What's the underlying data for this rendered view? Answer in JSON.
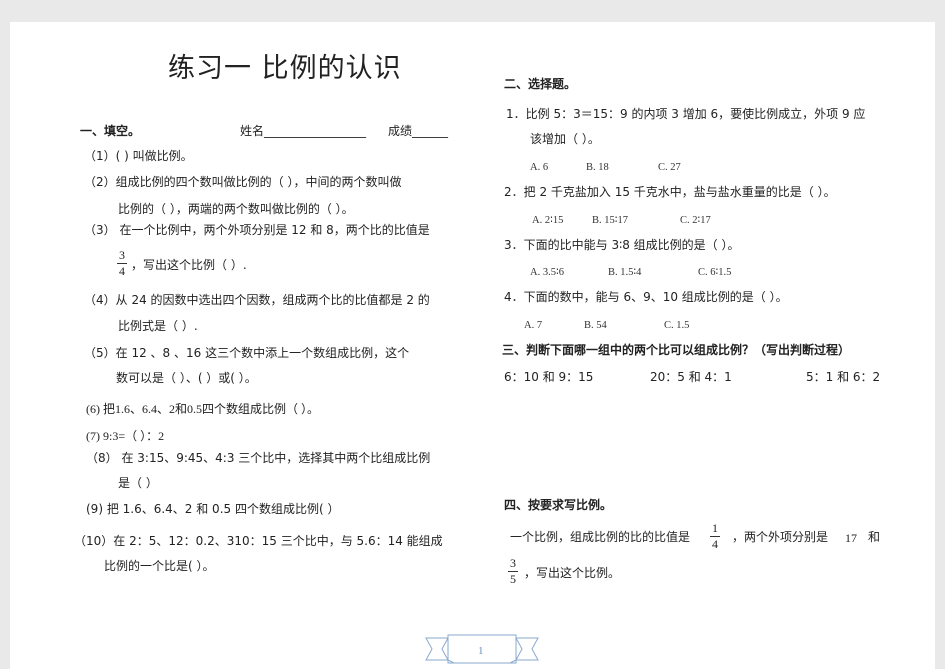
{
  "title": "练习一 比例的认识",
  "s1": {
    "heading": "一、填空。",
    "name_line": "姓名_________________",
    "score_line": "成绩______",
    "q1": "（1）(                                                      ) 叫做比例。",
    "q2a": "（2）组成比例的四个数叫做比例的（        ），中间的两个数叫做",
    "q2b": "比例的（            ），两端的两个数叫做比例的（            ）。",
    "q3a": "（3）  在一个比例中，两个外项分别是 12 和 8，两个比的比值是",
    "q3_num": "3",
    "q3_den": "4",
    "q3b": "，写出这个比例（                                          ）.",
    "q4a": "（4）从 24 的因数中选出四个因数，组成两个比的比值都是 2 的",
    "q4b": "比例式是（                                                    ）.",
    "q5a": "（5）在 12   、8   、16   这三个数中添上一个数组成比例，这个",
    "q5b": "数可以是（              ）、(              ）或(              ）。",
    "q6": "(6)  把1.6、6.4、2和0.5四个数组成比例（                                    ）。",
    "q7": "(7)   9:3=（      ）：2",
    "q8a": "（8）  在 3:15、9:45、4:3 三个比中，选择其中两个比组成比例",
    "q8b": "是（                          ）",
    "q9": "(9)  把 1.6、6.4、2 和 0.5 四个数组成比例(                                    ）",
    "q10a": "（10）在 2：5、12：0.2、310：15 三个比中，与 5.6：14 能组成",
    "q10b": "比例的一个比是(                   ）。"
  },
  "s2": {
    "heading": "二、选择题。",
    "q1a": "1．比例 5：3＝15：9 的内项 3 增加 6，要使比例成立，外项 9 应",
    "q1b": "该增加（        ）。",
    "q1_opts": [
      "A.   6",
      "B. 18",
      "C.   27"
    ],
    "q2": "2．把 2 千克盐加入 15 千克水中，盐与盐水重量的比是（          ）。",
    "q2_opts": [
      "A. 2∶15",
      "B.   15∶17",
      "C.   2∶17"
    ],
    "q3": "3．下面的比中能与 3∶8 组成比例的是（          ）。",
    "q3_opts": [
      "A.   3.5∶6",
      "B.   1.5∶4",
      "C.   6∶1.5"
    ],
    "q4": "4．下面的数中，能与 6、9、10 组成比例的是（          ）。",
    "q4_opts": [
      "A. 7",
      "B.   54",
      "C.   1.5"
    ]
  },
  "s3": {
    "heading": "三、判断下面哪一组中的两个比可以组成比例？（写出判断过程）",
    "items": [
      "6：10 和 9：15",
      "20：5 和 4：1",
      "5：1 和 6：2"
    ]
  },
  "s4": {
    "heading": "四、按要求写比例。",
    "text_a": "一个比例，组成比例的比的比值是",
    "frac1_num": "1",
    "frac1_den": "4",
    "text_b": "，两个外项分别是",
    "n17": "17",
    "and": "和",
    "frac2_num": "3",
    "frac2_den": "5",
    "text_c": "，写出这个比例。"
  },
  "page_number": "1"
}
